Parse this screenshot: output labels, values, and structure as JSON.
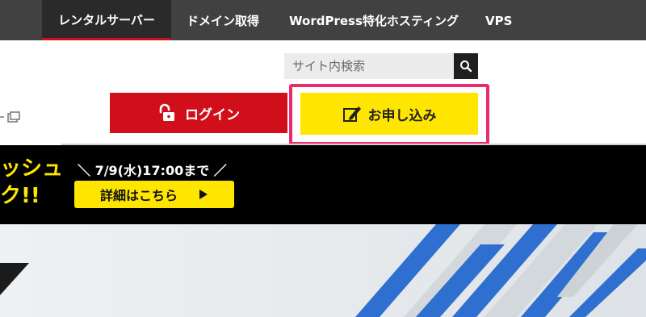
{
  "nav": {
    "items": [
      {
        "label": "レンタルサーバー",
        "active": true
      },
      {
        "label": "ドメイン取得",
        "active": false
      },
      {
        "label": "WordPress特化ホスティング",
        "active": false
      },
      {
        "label": "VPS",
        "active": false
      }
    ]
  },
  "search": {
    "placeholder": "サイト内検索"
  },
  "buttons": {
    "login_label": "ログイン",
    "apply_label": "お申し込み"
  },
  "banner": {
    "title_line1": "ッシュ",
    "title_line2": "ク!!",
    "deadline": "＼ 7/9(水)17:00まで ／",
    "details_label": "詳細はこちら"
  },
  "colors": {
    "nav_bg": "#414141",
    "accent_red": "#d10f1b",
    "accent_yellow": "#ffe600",
    "highlight_pink": "#ea2a6f",
    "hero_stripe_blue": "#2f6fd0"
  }
}
